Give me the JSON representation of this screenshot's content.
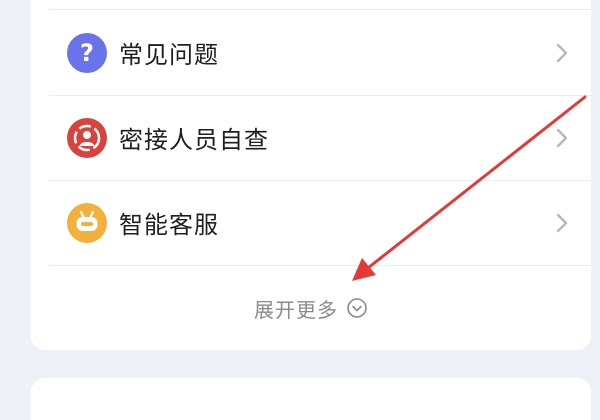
{
  "menu": {
    "items": [
      {
        "label": "常见问题",
        "icon": "question-icon",
        "color": "#6a73e9"
      },
      {
        "label": "密接人员自查",
        "icon": "contact-check-icon",
        "color": "#d8433f"
      },
      {
        "label": "智能客服",
        "icon": "robot-icon",
        "color": "#f4b03c"
      }
    ],
    "expand_label": "展开更多",
    "expand_icon": "chevron-down-circle-icon"
  },
  "next_section": {
    "title": ""
  },
  "annotation": {
    "arrow_color": "#e53935",
    "arrow_icon": "red-arrow-annotation"
  }
}
